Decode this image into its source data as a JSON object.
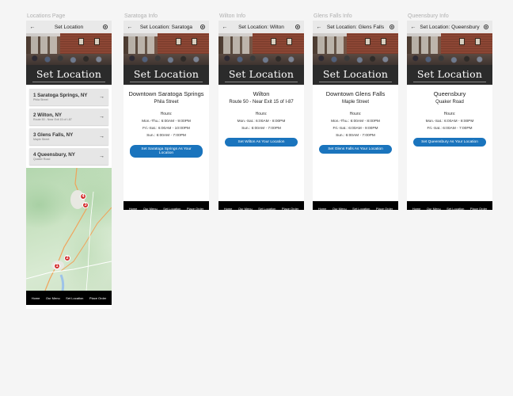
{
  "frames": [
    {
      "label": "Locations Page"
    },
    {
      "label": "Saratoga Info"
    },
    {
      "label": "Wilton Info"
    },
    {
      "label": "Glens Falls Info"
    },
    {
      "label": "Queensbury Info"
    }
  ],
  "hero_text": "Set Location",
  "nav": [
    "Home",
    "Our Menu",
    "Set Location",
    "Place Order"
  ],
  "icons": {
    "back": "arrow-left-icon",
    "account": "account-circle-icon",
    "forward": "arrow-right-icon"
  },
  "colors": {
    "cta": "#1a74bd",
    "pin": "#d22b2b",
    "nav_bg": "#000000",
    "banner_bg": "#2b2b2b"
  },
  "locations_page": {
    "appbar_title": "Set Location",
    "locations": [
      {
        "name": "1 Saratoga Springs, NY",
        "sub": "Phila Street"
      },
      {
        "name": "2 Wilton, NY",
        "sub": "Route 50 - Near Exit 15 of I-87"
      },
      {
        "name": "3 Glens Falls, NY",
        "sub": "Maple Street"
      },
      {
        "name": "4 Queensbury, NY",
        "sub": "Quaker Road"
      }
    ],
    "map_pins": [
      "1",
      "2",
      "3",
      "4"
    ]
  },
  "info_pages": [
    {
      "appbar_title": "Set Location: Saratoga",
      "title": "Downtown Saratoga Springs",
      "street": "Phila Street",
      "hours_label": "Hours:",
      "hours": [
        "Mon.-Thu.: 6:00AM - 9:00PM",
        "Fri.-Sat.: 6:00AM - 10:00PM",
        "Sun.: 6:00AM - 7:00PM"
      ],
      "cta": "Set Saratoga Springs As Your Location"
    },
    {
      "appbar_title": "Set Location: Wilton",
      "title": "Wilton",
      "street": "Route 50 - Near Exit 15 of I-87",
      "hours_label": "Hours:",
      "hours": [
        "Mon.-Sat.: 6:00AM - 8:00PM",
        "Sun.: 6:00AM - 7:00PM"
      ],
      "cta": "Set Wilton As Your Location"
    },
    {
      "appbar_title": "Set Location: Glens Falls",
      "title": "Downtown Glens Falls",
      "street": "Maple Street",
      "hours_label": "Hours:",
      "hours": [
        "Mon.-Thu.: 6:00AM - 8:00PM",
        "Fri.-Sat.: 6:00AM - 9:00PM",
        "Sun.: 6:00AM - 7:00PM"
      ],
      "cta": "Set Glens Falls As Your Location"
    },
    {
      "appbar_title": "Set Location: Queensbury",
      "title": "Queensbury",
      "street": "Quaker Road",
      "hours_label": "Hours:",
      "hours": [
        "Mon.-Sat.: 6:00AM - 8:00PM",
        "Fri.-Sat.: 6:00AM - 7:00PM"
      ],
      "cta": "Set Queensbury As Your Location"
    }
  ]
}
